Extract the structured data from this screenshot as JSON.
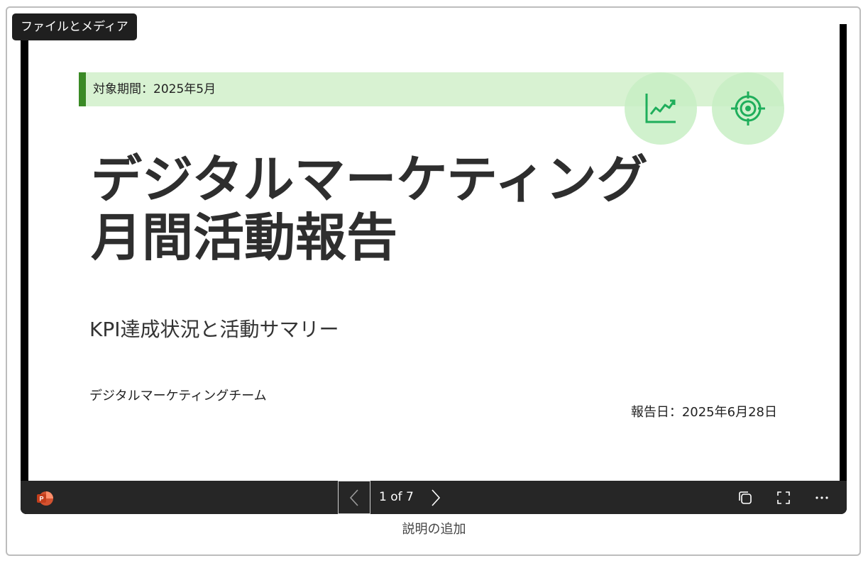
{
  "embed_label": "ファイルとメディア",
  "slide": {
    "period": "対象期間：2025年5月",
    "title_line1": "デジタルマーケティング",
    "title_line2": "月間活動報告",
    "subtitle": "KPI達成状況と活動サマリー",
    "team": "デジタルマーケティングチーム",
    "report_date": "報告日：2025年6月28日",
    "icons": [
      "chart-trend-icon",
      "target-icon"
    ],
    "colors": {
      "accent_green": "#3a8a25",
      "band_green": "#d8f2d2",
      "icon_green": "#1fae5b"
    }
  },
  "toolbar": {
    "app_icon": "powerpoint-icon",
    "page_indicator": "1 of 7",
    "current_page": 1,
    "total_pages": 7,
    "buttons": [
      "chevron-left-icon",
      "chevron-right-icon",
      "copy-icon",
      "fullscreen-icon",
      "more-icon"
    ]
  },
  "caption": "説明の追加"
}
